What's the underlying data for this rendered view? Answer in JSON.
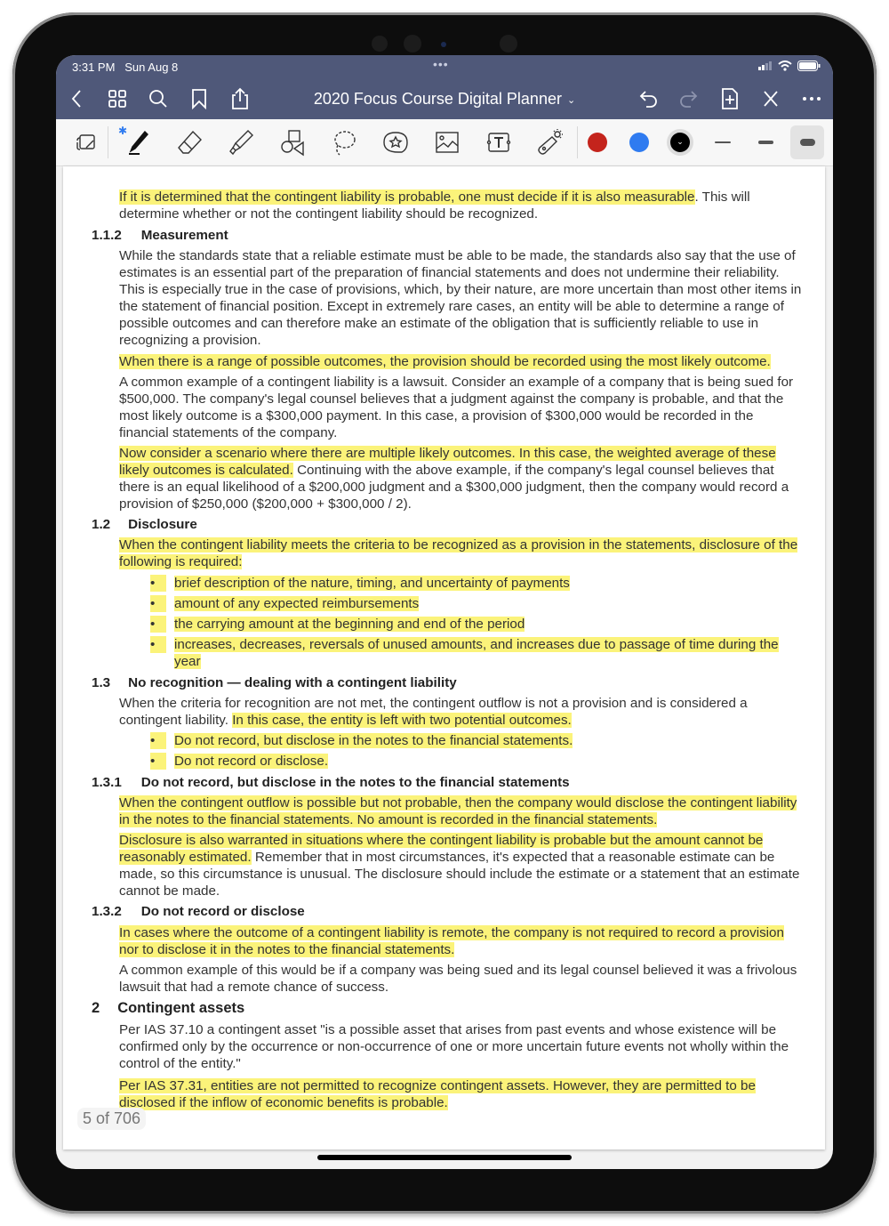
{
  "status_bar": {
    "time": "3:31 PM",
    "date": "Sun Aug 8",
    "handle": "•••"
  },
  "nav": {
    "title": "2020 Focus Course Digital Planner",
    "title_chevron": "⌄",
    "left_icons": [
      "back-icon",
      "grid-icon",
      "search-icon",
      "bookmark-icon",
      "share-icon"
    ],
    "right_icons": [
      "undo-icon",
      "redo-icon",
      "add-page-icon",
      "close-toolbar-icon",
      "more-icon"
    ]
  },
  "toolbar": {
    "tools": [
      "zoom-window-tool",
      "pen-tool",
      "eraser-tool",
      "highlighter-tool",
      "shapes-tool",
      "lasso-tool",
      "sticker-tool",
      "image-tool",
      "text-tool",
      "laser-pointer-tool"
    ],
    "bluetooth_label": "✱",
    "colors": [
      "#c4241c",
      "#2f7bf0",
      "#000000"
    ],
    "selected_color_glyph": "⌄",
    "stroke_widths": [
      "thin",
      "medium",
      "thick"
    ],
    "selected_stroke": "thick"
  },
  "document": {
    "blocks": [
      {
        "type": "p",
        "segments": [
          {
            "t": "If it is determined that the contingent liability is probable, one must decide if it is also measurable",
            "hl": true
          },
          {
            "t": ". This will determine whether or not the contingent liability should be recognized.",
            "hl": false
          }
        ]
      },
      {
        "type": "h",
        "num": "1.1.2",
        "title": "Measurement"
      },
      {
        "type": "p",
        "segments": [
          {
            "t": "While the standards state that a reliable estimate must be able to be made, the standards also say that the use of estimates is an essential part of the preparation of financial statements and does not undermine their reliability. This is especially true in the case of provisions, which, by their nature, are more uncertain than most other items in the statement of financial position. Except in extremely rare cases, an entity will be able to determine a range of possible outcomes and can therefore make an estimate of the obligation that is sufficiently reliable to use in recognizing a provision.",
            "hl": false
          }
        ]
      },
      {
        "type": "p",
        "segments": [
          {
            "t": "When there is a range of possible outcomes, the provision should be recorded using the most likely outcome.",
            "hl": true
          }
        ]
      },
      {
        "type": "p",
        "segments": [
          {
            "t": "A common example of a contingent liability is a lawsuit. Consider an example of a company that is being sued for $500,000. The company's legal counsel believes that a judgment against the company is probable, and that the most likely outcome is a $300,000 payment. In this case, a provision of $300,000 would be recorded in the financial statements of the company.",
            "hl": false
          }
        ]
      },
      {
        "type": "p",
        "segments": [
          {
            "t": "Now consider a scenario where there are multiple likely outcomes. In this case, the weighted average of these likely outcomes is calculated.",
            "hl": true
          },
          {
            "t": " Continuing with the above example, if the company's legal counsel believes that there is an equal likelihood of a $200,000 judgment and a $300,000 judgment, then the company would record a provision of $250,000 ($200,000 + $300,000 / 2).",
            "hl": false
          }
        ]
      },
      {
        "type": "h",
        "num": "1.2",
        "title": "Disclosure"
      },
      {
        "type": "p",
        "segments": [
          {
            "t": "When the contingent liability meets the criteria to be recognized as a provision in the statements, disclosure of the following is required:",
            "hl": true
          }
        ]
      },
      {
        "type": "li",
        "text": "brief description of the nature, timing, and uncertainty of payments"
      },
      {
        "type": "li",
        "text": "amount of any expected reimbursements"
      },
      {
        "type": "li",
        "text": "the carrying amount at the beginning and end of the period"
      },
      {
        "type": "li",
        "text": "increases, decreases, reversals of unused amounts, and increases due to passage of time during the year"
      },
      {
        "type": "h",
        "num": "1.3",
        "title": "No recognition — dealing with a contingent liability"
      },
      {
        "type": "p",
        "segments": [
          {
            "t": "When the criteria for recognition are not met, the contingent outflow is not a provision and is considered a contingent liability. ",
            "hl": false
          },
          {
            "t": "In this case, the entity is left with two potential outcomes.",
            "hl": true
          }
        ]
      },
      {
        "type": "li",
        "text": "Do not record, but disclose in the notes to the financial statements."
      },
      {
        "type": "li",
        "text": "Do not record or disclose."
      },
      {
        "type": "h",
        "num": "1.3.1",
        "title": "Do not record, but disclose in the notes to the financial statements"
      },
      {
        "type": "p",
        "segments": [
          {
            "t": "When the contingent outflow is possible but not probable, then the company would disclose the contingent liability in the notes to the financial statements. No amount is recorded in the financial statements.",
            "hl": true
          }
        ]
      },
      {
        "type": "p",
        "segments": [
          {
            "t": "Disclosure is also warranted in situations where the contingent liability is probable but the amount cannot be reasonably estimated.",
            "hl": true
          },
          {
            "t": " Remember that in most circumstances, it's expected that a reasonable estimate can be made, so this circumstance is unusual. The disclosure should include the estimate or a statement that an estimate cannot be made.",
            "hl": false
          }
        ]
      },
      {
        "type": "h",
        "num": "1.3.2",
        "title": "Do not record or disclose"
      },
      {
        "type": "p",
        "segments": [
          {
            "t": "In cases where the outcome of a contingent liability is remote, the company is not required to record a provision nor to disclose it in the notes to the financial statements.",
            "hl": true
          }
        ]
      },
      {
        "type": "p",
        "segments": [
          {
            "t": "A common example of this would be if a company was being sued and its legal counsel believed it was a frivolous lawsuit that had a remote chance of success.",
            "hl": false
          }
        ]
      },
      {
        "type": "h",
        "num": "2",
        "title": "Contingent assets"
      },
      {
        "type": "p",
        "segments": [
          {
            "t": "Per IAS 37.10 a contingent asset \"is a possible asset that arises from past events and whose existence will be confirmed only by the occurrence or non-occurrence of one or more uncertain future events not wholly within the control of the entity.\"",
            "hl": false
          }
        ]
      },
      {
        "type": "p",
        "segments": [
          {
            "t": "Per IAS 37.31, entities are not permitted to recognize contingent assets. However, they are permitted to be disclosed if the inflow of economic benefits is probable.",
            "hl": true
          }
        ]
      }
    ]
  },
  "page_indicator": "5 of 706"
}
